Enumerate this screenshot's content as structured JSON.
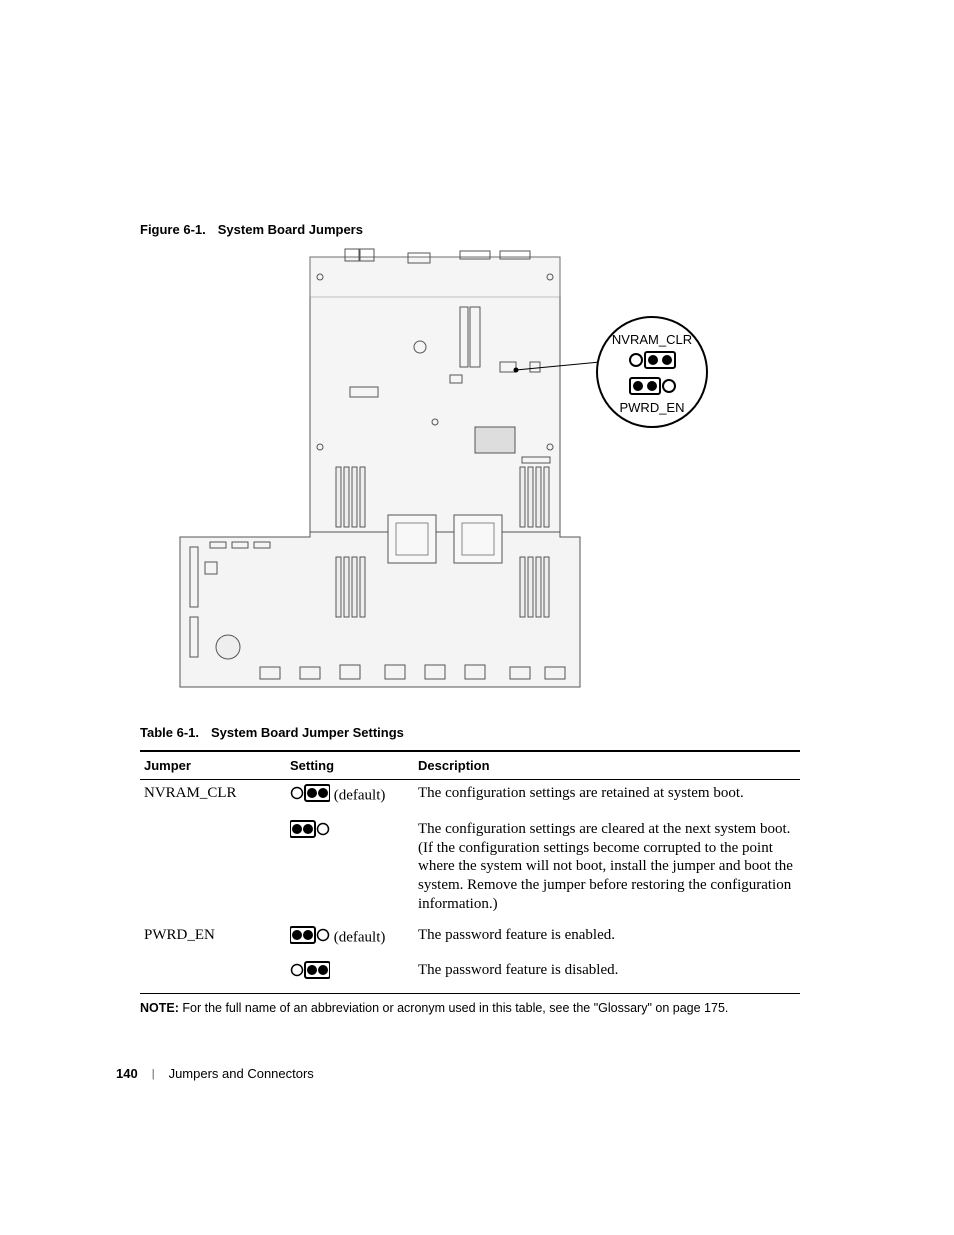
{
  "figure": {
    "ref": "Figure 6-1.",
    "title": "System Board Jumpers",
    "callouts": {
      "top": "NVRAM_CLR",
      "bottom": "PWRD_EN"
    }
  },
  "table": {
    "ref": "Table 6-1.",
    "title": "System Board Jumper Settings",
    "headers": {
      "jumper": "Jumper",
      "setting": "Setting",
      "description": "Description"
    },
    "default_label": "(default)",
    "rows": [
      {
        "jumper": "NVRAM_CLR",
        "settings": [
          {
            "icon": "pins-23",
            "is_default": true,
            "description": "The configuration settings are retained at system boot."
          },
          {
            "icon": "pins-12",
            "is_default": false,
            "description": "The configuration settings are cleared at the next system boot. (If the configuration settings become corrupted to the point where the system will not boot, install the jumper and boot the system. Remove the jumper before restoring the configuration information.)"
          }
        ]
      },
      {
        "jumper": "PWRD_EN",
        "settings": [
          {
            "icon": "pins-12",
            "is_default": true,
            "description": "The password feature is enabled."
          },
          {
            "icon": "pins-23",
            "is_default": false,
            "description": "The password feature is disabled."
          }
        ]
      }
    ]
  },
  "note": {
    "label": "NOTE:",
    "text": "For the full name of an abbreviation or acronym used in this table, see the \"Glossary\" on page 175."
  },
  "footer": {
    "page": "140",
    "section": "Jumpers and Connectors"
  }
}
